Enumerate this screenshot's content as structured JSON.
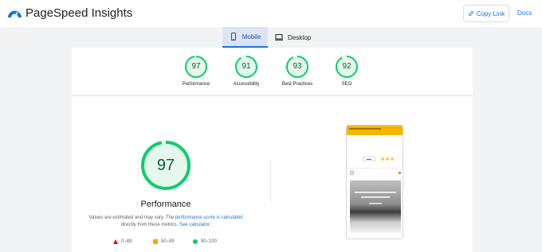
{
  "app": {
    "title": "PageSpeed Insights",
    "copy_link_label": "Copy Link",
    "docs_label": "Docs",
    "logo_icon": "pagespeed-logo-icon",
    "link_icon": "link-icon"
  },
  "tabs": [
    {
      "label": "Mobile",
      "icon": "mobile-icon",
      "selected": true
    },
    {
      "label": "Desktop",
      "icon": "desktop-icon",
      "selected": false
    }
  ],
  "categories": [
    {
      "label": "Performance",
      "score": "97",
      "fraction": 0.97
    },
    {
      "label": "Accessibility",
      "score": "91",
      "fraction": 0.91
    },
    {
      "label": "Best Practices",
      "score": "93",
      "fraction": 0.93
    },
    {
      "label": "SEO",
      "score": "92",
      "fraction": 0.92
    }
  ],
  "performance": {
    "score": "97",
    "fraction": 0.97,
    "title": "Performance",
    "note_prefix": "Values are estimated and may vary. The ",
    "note_link": "performance score is calculated",
    "note_middle": " directly from these metrics. ",
    "note_link2": "See calculator."
  },
  "legend": [
    {
      "label": "0–49",
      "shape": "triangle",
      "color": "#ff0000"
    },
    {
      "label": "50–89",
      "shape": "square",
      "color": "#ffa400"
    },
    {
      "label": "90–100",
      "shape": "circle",
      "color": "#0cce6b"
    }
  ],
  "colors": {
    "good": "#0cce6b",
    "good_text": "#0d652d",
    "accent": "#1a73e8"
  }
}
